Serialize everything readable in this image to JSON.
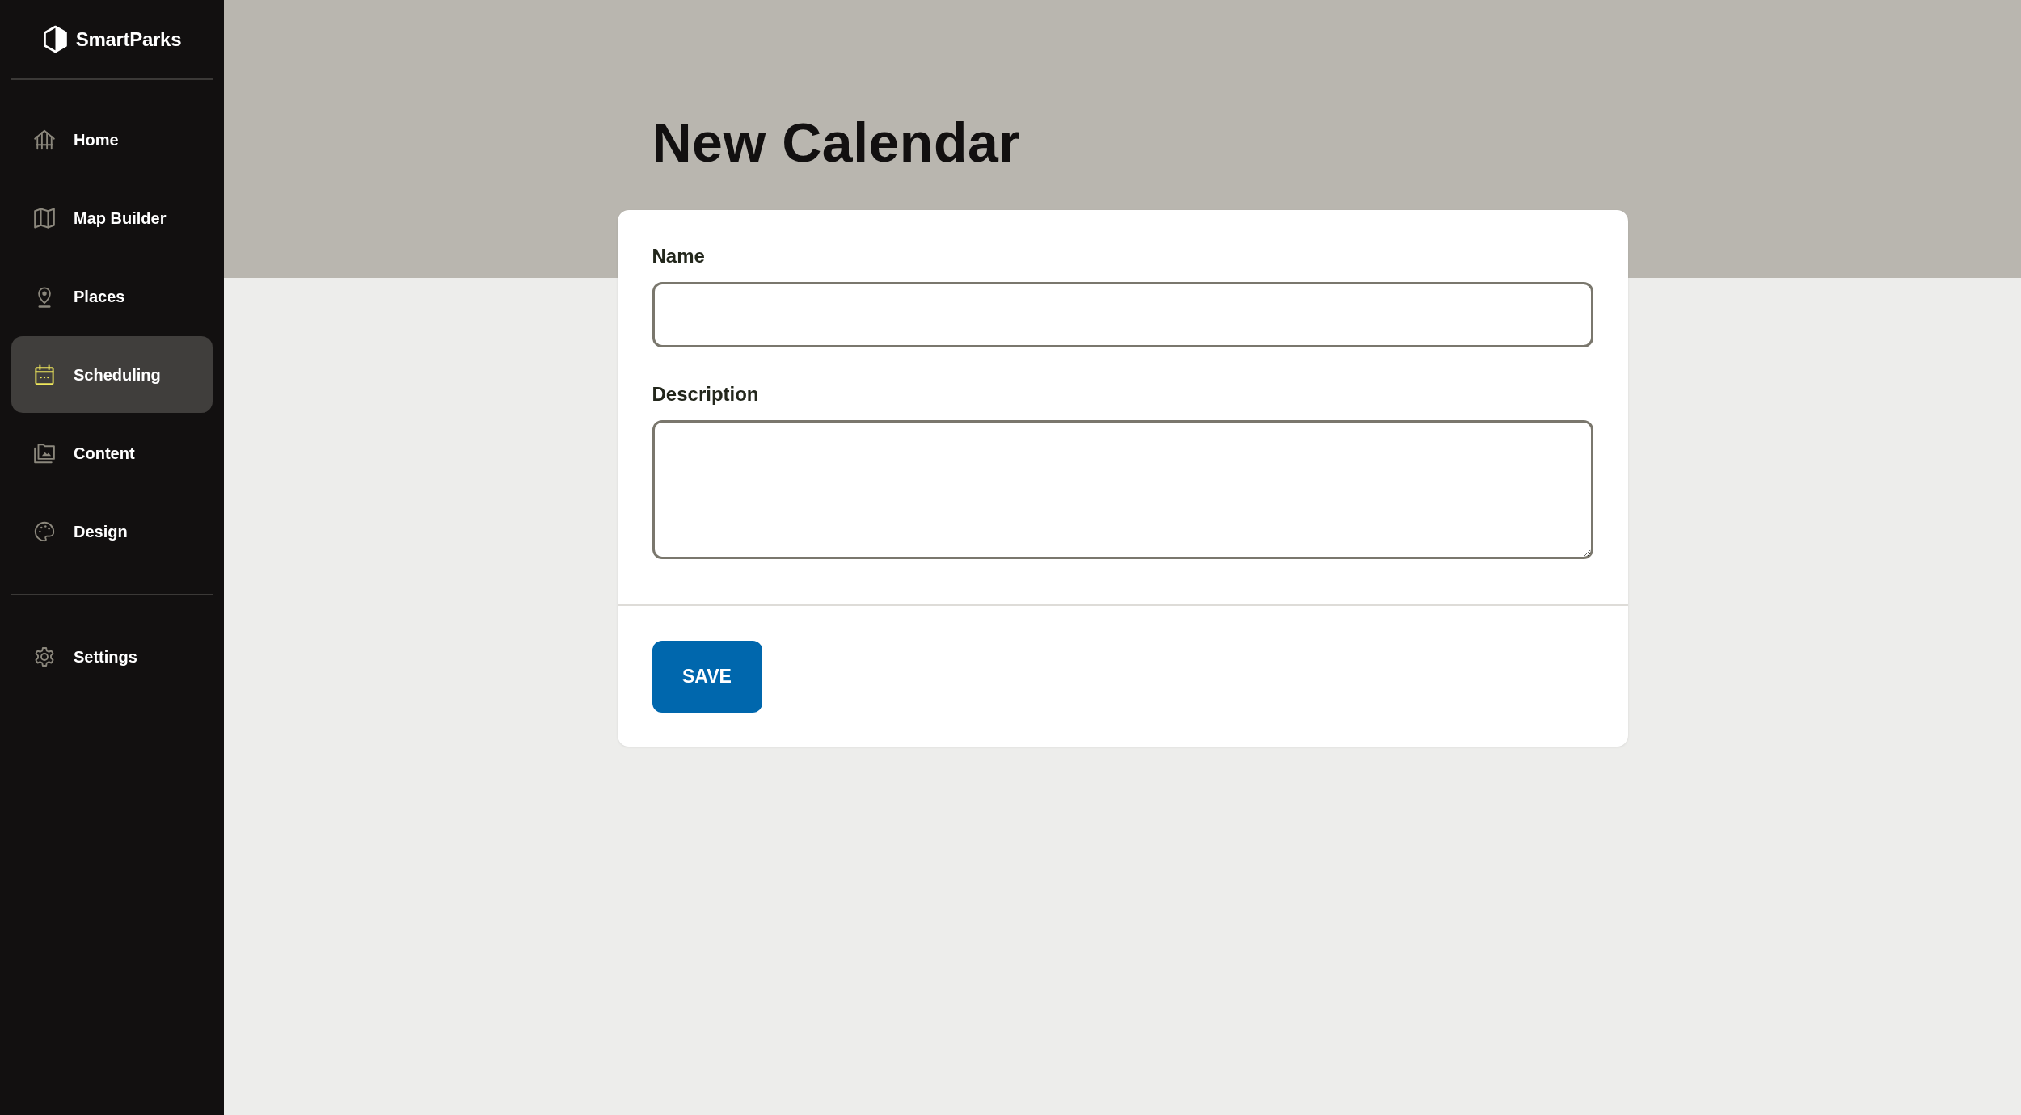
{
  "sidebar": {
    "brand": "SmartParks",
    "items": [
      {
        "label": "Home",
        "selected": false
      },
      {
        "label": "Map Builder",
        "selected": false
      },
      {
        "label": "Places",
        "selected": false
      },
      {
        "label": "Scheduling",
        "selected": true
      },
      {
        "label": "Content",
        "selected": false
      },
      {
        "label": "Design",
        "selected": false
      }
    ],
    "footer_items": [
      {
        "label": "Settings",
        "selected": false
      }
    ]
  },
  "page": {
    "title": "New Calendar"
  },
  "form": {
    "fields": [
      {
        "label": "Name",
        "kind": "input"
      },
      {
        "label": "Description",
        "kind": "textarea"
      }
    ],
    "submit": {
      "label": "SAVE"
    }
  }
}
